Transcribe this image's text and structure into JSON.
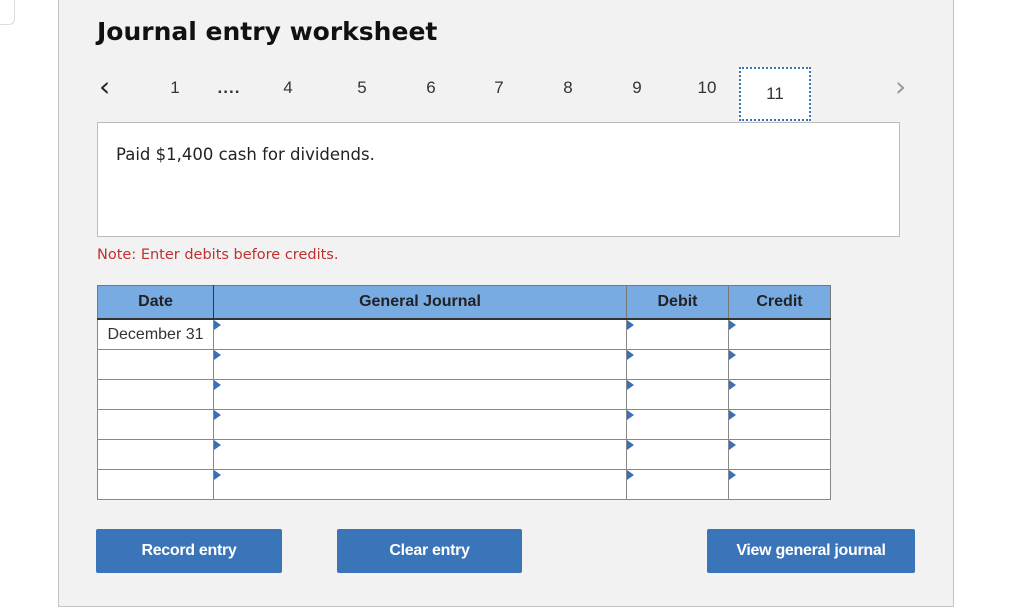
{
  "title": "Journal entry worksheet",
  "pager": {
    "prev_icon": "chevron-left-icon",
    "next_icon": "chevron-right-icon",
    "items": [
      "1",
      "....",
      "4",
      "5",
      "6",
      "7",
      "8",
      "9",
      "10",
      "11"
    ],
    "current": "11"
  },
  "prompt": "Paid $1,400 cash for dividends.",
  "note": "Note: Enter debits before credits.",
  "table": {
    "headers": {
      "date": "Date",
      "journal": "General Journal",
      "debit": "Debit",
      "credit": "Credit"
    },
    "rows": [
      {
        "date": "December 31",
        "account": "",
        "debit": "",
        "credit": ""
      },
      {
        "date": "",
        "account": "",
        "debit": "",
        "credit": ""
      },
      {
        "date": "",
        "account": "",
        "debit": "",
        "credit": ""
      },
      {
        "date": "",
        "account": "",
        "debit": "",
        "credit": ""
      },
      {
        "date": "",
        "account": "",
        "debit": "",
        "credit": ""
      },
      {
        "date": "",
        "account": "",
        "debit": "",
        "credit": ""
      }
    ]
  },
  "buttons": {
    "record": "Record entry",
    "clear": "Clear entry",
    "view": "View general journal"
  },
  "colors": {
    "accent": "#3a75b9",
    "header_bg": "#79abe3",
    "note": "#c0302e"
  }
}
